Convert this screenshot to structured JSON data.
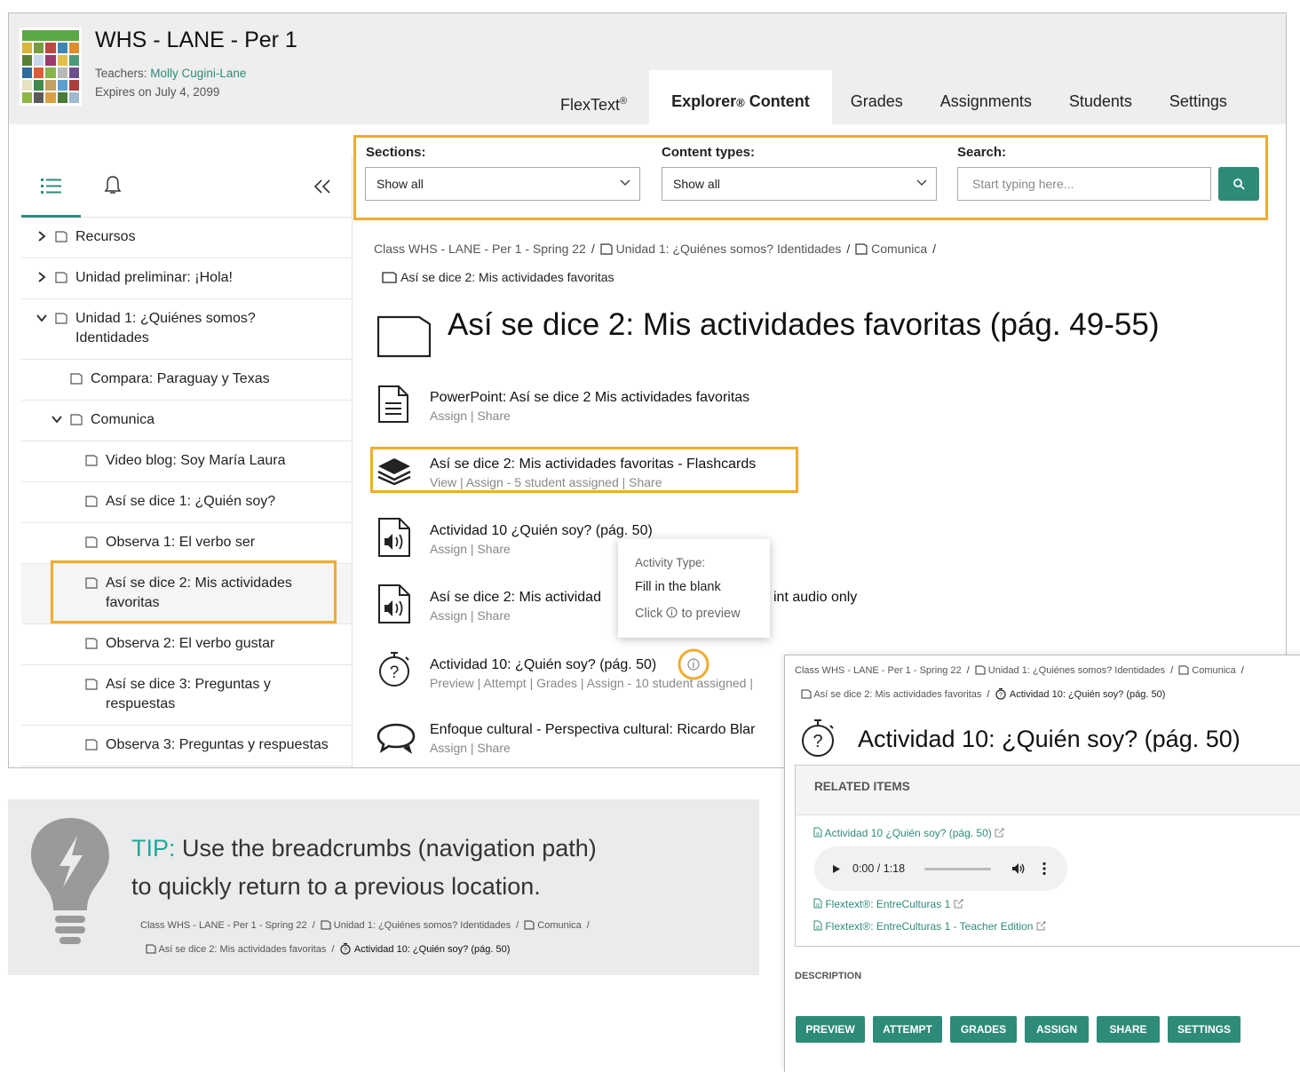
{
  "header": {
    "course_title": "WHS - LANE - Per 1",
    "teachers_label": "Teachers:",
    "teacher_name": "Molly Cugini-Lane",
    "expires": "Expires on July 4, 2099",
    "tabs": [
      {
        "label": "FlexText®",
        "active": false
      },
      {
        "label": "Explorer® Content",
        "active": true
      },
      {
        "label": "Grades",
        "active": false
      },
      {
        "label": "Assignments",
        "active": false
      },
      {
        "label": "Students",
        "active": false
      },
      {
        "label": "Settings",
        "active": false
      }
    ]
  },
  "sidebar": {
    "items": [
      {
        "label": "Recursos",
        "chevron": "right"
      },
      {
        "label": "Unidad preliminar: ¡Hola!",
        "chevron": "right"
      },
      {
        "label": "Unidad 1: ¿Quiénes somos?",
        "label2": "Identidades",
        "chevron": "down"
      },
      {
        "label": "Compara: Paraguay y Texas"
      },
      {
        "label": "Comunica",
        "chevron": "down"
      },
      {
        "label": "Video blog: Soy María Laura"
      },
      {
        "label": "Así se dice 1: ¿Quién soy?"
      },
      {
        "label": "Observa 1: El verbo ser"
      },
      {
        "label": "Así se dice 2: Mis actividades",
        "label2": "favoritas",
        "selected": true
      },
      {
        "label": "Observa 2: El verbo gustar"
      },
      {
        "label": "Así se dice 3: Preguntas y",
        "label2": "respuestas"
      },
      {
        "label": "Observa 3: Preguntas y respuestas"
      }
    ]
  },
  "filters": {
    "sections_label": "Sections:",
    "sections_value": "Show all",
    "types_label": "Content types:",
    "types_value": "Show all",
    "search_label": "Search:",
    "search_placeholder": "Start typing here..."
  },
  "breadcrumb": {
    "c1": "Class WHS - LANE - Per 1 - Spring 22",
    "c2": "Unidad 1: ¿Quiénes somos? Identidades",
    "c3": "Comunica",
    "c4": "Así se dice 2: Mis actividades favoritas",
    "c5": "Actividad 10: ¿Quién soy? (pág. 50)",
    "sep": "/"
  },
  "page_title": "Así se dice 2: Mis actividades favoritas (pág. 49-55)",
  "content_items": [
    {
      "title": "PowerPoint: Así se dice 2 Mis actividades favoritas",
      "actions": "Assign | Share",
      "icon": "document-icon"
    },
    {
      "title": "Así se dice 2: Mis actividades favoritas - Flashcards",
      "actions": "View | Assign - 5 student assigned | Share",
      "icon": "layers-icon"
    },
    {
      "title": "Actividad 10 ¿Quién soy? (pág. 50)",
      "actions": "Assign | Share",
      "icon": "audio-file-icon"
    },
    {
      "title": "Así se dice 2: Mis actividad",
      "title_tail": "int audio only",
      "actions": "Assign | Share",
      "icon": "audio-file-icon"
    },
    {
      "title": "Actividad 10: ¿Quién soy? (pág. 50)",
      "actions": "Preview | Attempt | Grades | Assign - 10 student assigned |",
      "icon": "stopwatch-question-icon"
    },
    {
      "title": "Enfoque cultural - Perspectiva cultural: Ricardo Blar",
      "actions": "Assign | Share",
      "icon": "chat-bubbles-icon"
    }
  ],
  "tooltip": {
    "type_label": "Activity Type:",
    "type_value": "Fill in the blank",
    "hint_pre": "Click",
    "hint_post": "to preview"
  },
  "detail": {
    "title": "Actividad 10: ¿Quién soy? (pág. 50)",
    "related_header": "RELATED ITEMS",
    "related": [
      "Actividad 10 ¿Quién soy? (pág. 50)",
      "Flextext®: EntreCulturas 1",
      "Flextext®: EntreCulturas 1 - Teacher Edition"
    ],
    "player_time": "0:00 / 1:18",
    "audio_progress": 0,
    "description_label": "DESCRIPTION",
    "buttons": [
      "PREVIEW",
      "ATTEMPT",
      "GRADES",
      "ASSIGN",
      "SHARE",
      "SETTINGS"
    ]
  },
  "tip": {
    "label": "TIP:",
    "line1": " Use the breadcrumbs (navigation path)",
    "line2": "to quickly return to a previous location."
  },
  "colors": {
    "accent": "#2e8b7a",
    "highlight": "#f0ac2f",
    "tip_teal": "#1fa99a"
  }
}
